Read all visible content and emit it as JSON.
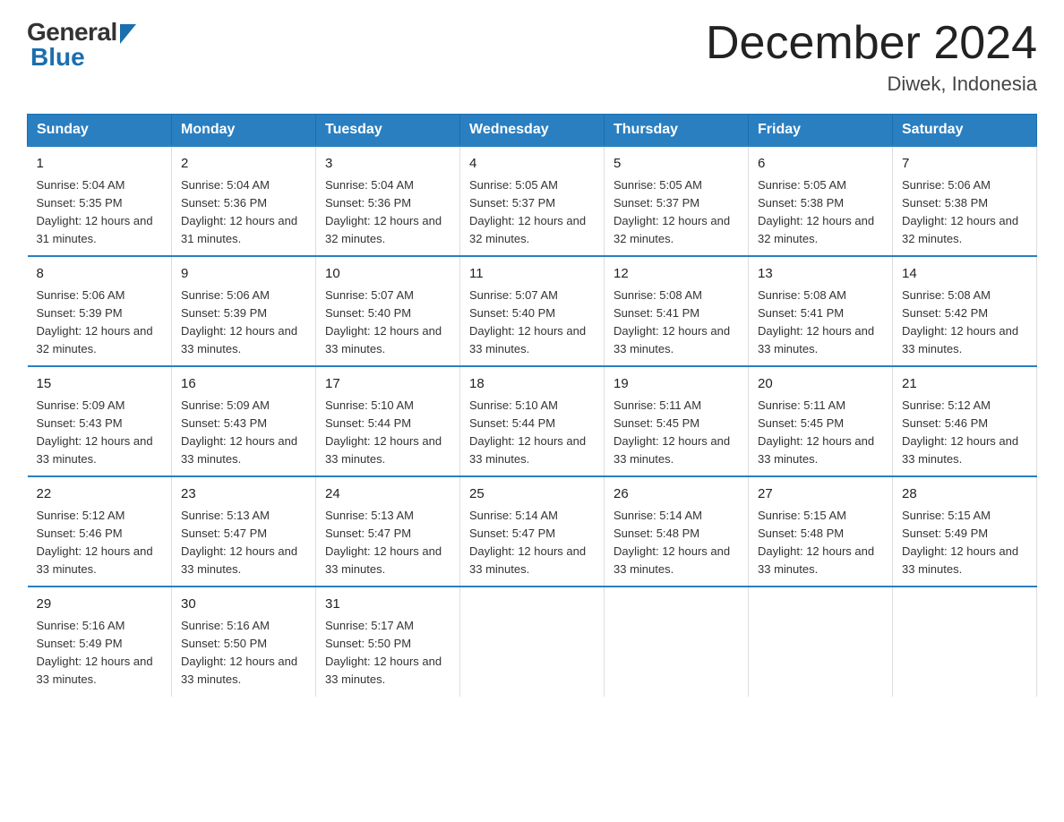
{
  "logo": {
    "text_general": "General",
    "text_blue": "Blue"
  },
  "title": "December 2024",
  "location": "Diwek, Indonesia",
  "days_of_week": [
    "Sunday",
    "Monday",
    "Tuesday",
    "Wednesday",
    "Thursday",
    "Friday",
    "Saturday"
  ],
  "weeks": [
    [
      {
        "day": "1",
        "sunrise": "5:04 AM",
        "sunset": "5:35 PM",
        "daylight": "12 hours and 31 minutes."
      },
      {
        "day": "2",
        "sunrise": "5:04 AM",
        "sunset": "5:36 PM",
        "daylight": "12 hours and 31 minutes."
      },
      {
        "day": "3",
        "sunrise": "5:04 AM",
        "sunset": "5:36 PM",
        "daylight": "12 hours and 32 minutes."
      },
      {
        "day": "4",
        "sunrise": "5:05 AM",
        "sunset": "5:37 PM",
        "daylight": "12 hours and 32 minutes."
      },
      {
        "day": "5",
        "sunrise": "5:05 AM",
        "sunset": "5:37 PM",
        "daylight": "12 hours and 32 minutes."
      },
      {
        "day": "6",
        "sunrise": "5:05 AM",
        "sunset": "5:38 PM",
        "daylight": "12 hours and 32 minutes."
      },
      {
        "day": "7",
        "sunrise": "5:06 AM",
        "sunset": "5:38 PM",
        "daylight": "12 hours and 32 minutes."
      }
    ],
    [
      {
        "day": "8",
        "sunrise": "5:06 AM",
        "sunset": "5:39 PM",
        "daylight": "12 hours and 32 minutes."
      },
      {
        "day": "9",
        "sunrise": "5:06 AM",
        "sunset": "5:39 PM",
        "daylight": "12 hours and 33 minutes."
      },
      {
        "day": "10",
        "sunrise": "5:07 AM",
        "sunset": "5:40 PM",
        "daylight": "12 hours and 33 minutes."
      },
      {
        "day": "11",
        "sunrise": "5:07 AM",
        "sunset": "5:40 PM",
        "daylight": "12 hours and 33 minutes."
      },
      {
        "day": "12",
        "sunrise": "5:08 AM",
        "sunset": "5:41 PM",
        "daylight": "12 hours and 33 minutes."
      },
      {
        "day": "13",
        "sunrise": "5:08 AM",
        "sunset": "5:41 PM",
        "daylight": "12 hours and 33 minutes."
      },
      {
        "day": "14",
        "sunrise": "5:08 AM",
        "sunset": "5:42 PM",
        "daylight": "12 hours and 33 minutes."
      }
    ],
    [
      {
        "day": "15",
        "sunrise": "5:09 AM",
        "sunset": "5:43 PM",
        "daylight": "12 hours and 33 minutes."
      },
      {
        "day": "16",
        "sunrise": "5:09 AM",
        "sunset": "5:43 PM",
        "daylight": "12 hours and 33 minutes."
      },
      {
        "day": "17",
        "sunrise": "5:10 AM",
        "sunset": "5:44 PM",
        "daylight": "12 hours and 33 minutes."
      },
      {
        "day": "18",
        "sunrise": "5:10 AM",
        "sunset": "5:44 PM",
        "daylight": "12 hours and 33 minutes."
      },
      {
        "day": "19",
        "sunrise": "5:11 AM",
        "sunset": "5:45 PM",
        "daylight": "12 hours and 33 minutes."
      },
      {
        "day": "20",
        "sunrise": "5:11 AM",
        "sunset": "5:45 PM",
        "daylight": "12 hours and 33 minutes."
      },
      {
        "day": "21",
        "sunrise": "5:12 AM",
        "sunset": "5:46 PM",
        "daylight": "12 hours and 33 minutes."
      }
    ],
    [
      {
        "day": "22",
        "sunrise": "5:12 AM",
        "sunset": "5:46 PM",
        "daylight": "12 hours and 33 minutes."
      },
      {
        "day": "23",
        "sunrise": "5:13 AM",
        "sunset": "5:47 PM",
        "daylight": "12 hours and 33 minutes."
      },
      {
        "day": "24",
        "sunrise": "5:13 AM",
        "sunset": "5:47 PM",
        "daylight": "12 hours and 33 minutes."
      },
      {
        "day": "25",
        "sunrise": "5:14 AM",
        "sunset": "5:47 PM",
        "daylight": "12 hours and 33 minutes."
      },
      {
        "day": "26",
        "sunrise": "5:14 AM",
        "sunset": "5:48 PM",
        "daylight": "12 hours and 33 minutes."
      },
      {
        "day": "27",
        "sunrise": "5:15 AM",
        "sunset": "5:48 PM",
        "daylight": "12 hours and 33 minutes."
      },
      {
        "day": "28",
        "sunrise": "5:15 AM",
        "sunset": "5:49 PM",
        "daylight": "12 hours and 33 minutes."
      }
    ],
    [
      {
        "day": "29",
        "sunrise": "5:16 AM",
        "sunset": "5:49 PM",
        "daylight": "12 hours and 33 minutes."
      },
      {
        "day": "30",
        "sunrise": "5:16 AM",
        "sunset": "5:50 PM",
        "daylight": "12 hours and 33 minutes."
      },
      {
        "day": "31",
        "sunrise": "5:17 AM",
        "sunset": "5:50 PM",
        "daylight": "12 hours and 33 minutes."
      },
      null,
      null,
      null,
      null
    ]
  ]
}
